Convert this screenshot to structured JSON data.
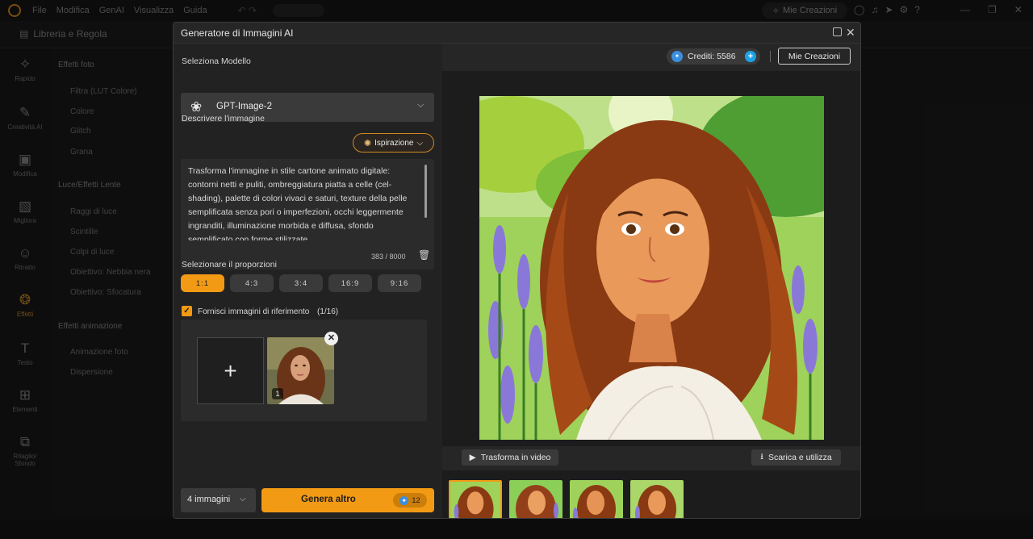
{
  "topbar": {
    "menus": [
      "File",
      "Modifica",
      "GenAI",
      "Visualizza",
      "Guida"
    ],
    "mie_creazioni": "Mie Creazioni"
  },
  "libbar": {
    "title": "Libreria e Regola"
  },
  "rail": [
    {
      "icon": "rapido-icon",
      "label": "Rapido"
    },
    {
      "icon": "creativita-icon",
      "label": "Creatività AI"
    },
    {
      "icon": "modifica-icon",
      "label": "Modifica"
    },
    {
      "icon": "migliora-icon",
      "label": "Migliora"
    },
    {
      "icon": "ritratto-icon",
      "label": "Ritratto"
    },
    {
      "icon": "effetti-icon",
      "label": "Effetti"
    },
    {
      "icon": "testo-icon",
      "label": "Testo"
    },
    {
      "icon": "elementi-icon",
      "label": "Elementi"
    },
    {
      "icon": "ritaglio-icon",
      "label": "Ritaglio/\nSfondo"
    }
  ],
  "effects": {
    "foto_header": "Effetti foto",
    "foto_items": [
      "Filtra (LUT Colore)",
      "Colore",
      "Glitch",
      "Grana"
    ],
    "luce_header": "Luce/Effetti Lente",
    "luce_items": [
      "Raggi di luce",
      "Scintille",
      "Colpi di luce",
      "Obiettivo: Nebbia nera",
      "Obiettivo: Sfocatura"
    ],
    "anim_header": "Effetti animazione",
    "anim_items": [
      "Animazione foto",
      "Dispersione"
    ]
  },
  "dialog": {
    "title": "Generatore di Immagini AI",
    "model_label": "Seleziona Modello",
    "model_value": "GPT-Image-2",
    "describe_label": "Descrivere l'immagine",
    "inspiration_label": "Ispirazione",
    "prompt": "Trasforma l'immagine in stile cartone animato digitale: contorni netti e puliti, ombreggiatura piatta a celle (cel-shading), palette di colori vivaci e saturi, texture della pelle semplificata senza pori o imperfezioni, occhi leggermente ingranditi, illuminazione morbida e diffusa, sfondo semplificato con forme stilizzate.",
    "char_count": "383 / 8000",
    "ratio_label": "Selezionare il proporzioni",
    "ratios": [
      "1:1",
      "4:3",
      "3:4",
      "16:9",
      "9:16"
    ],
    "selected_ratio": "1:1",
    "ref_label": "Fornisci immagini di riferimento",
    "ref_count": "(1/16)",
    "ref_badge": "1",
    "num_images": "4 immagini",
    "generate_label": "Genera altro",
    "generate_cost": "12",
    "credits": "Crediti: 5586",
    "mie_creazioni": "Mie Creazioni",
    "video_label": "Trasforma in video",
    "download_label": "Scarica e utilizza"
  },
  "colors": {
    "accent": "#f29a14",
    "credit_blue": "#1aa3e8"
  }
}
